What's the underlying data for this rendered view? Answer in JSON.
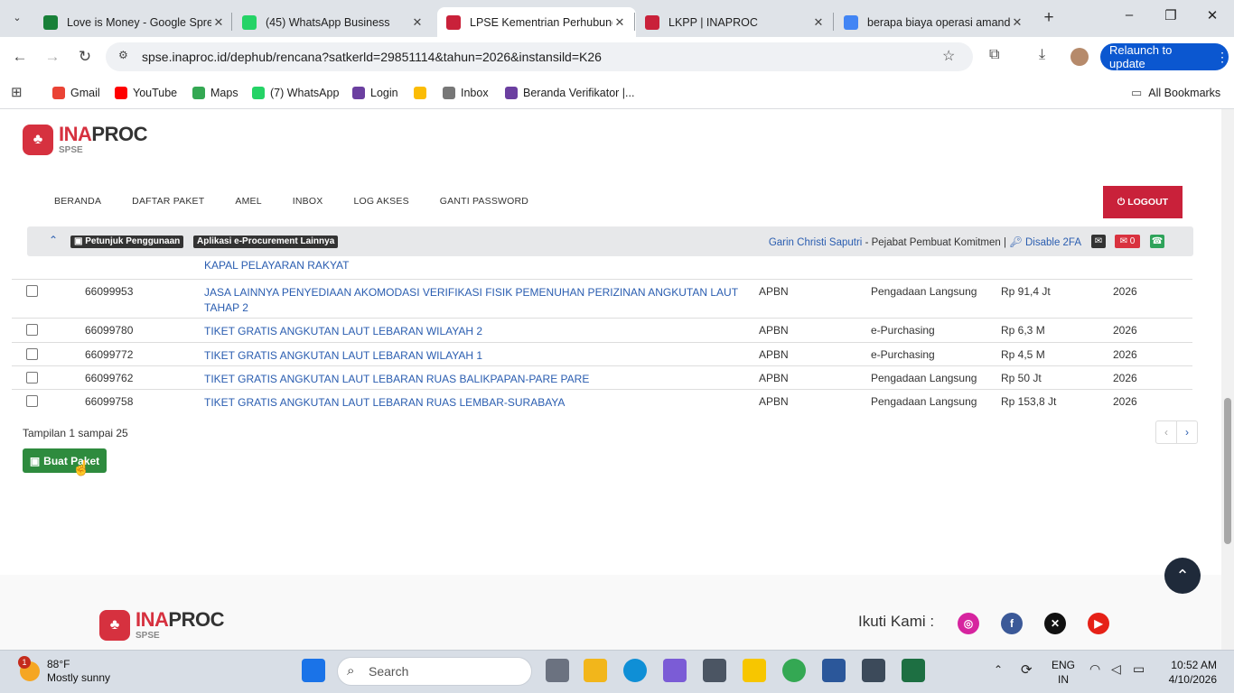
{
  "browser": {
    "tabs": [
      {
        "title": "Love is Money - Google Spre",
        "icon": "sheets-icon",
        "color": "#188038"
      },
      {
        "title": "(45) WhatsApp Business",
        "icon": "whatsapp-icon",
        "color": "#25d366"
      },
      {
        "title": "LPSE Kementrian Perhubung",
        "icon": "lpse-icon",
        "color": "#c9213a"
      },
      {
        "title": "LKPP | INAPROC",
        "icon": "lkpp-icon",
        "color": "#c9213a"
      },
      {
        "title": "berapa biaya operasi amand",
        "icon": "google-icon",
        "color": "#4285f4"
      }
    ],
    "url": "spse.inaproc.id/dephub/rencana?satkerld=29851114&tahun=2026&instansild=K26",
    "relaunch_label": "Relaunch to update",
    "bookmarks": [
      {
        "label": "Gmail",
        "color": "#ea4335"
      },
      {
        "label": "YouTube",
        "color": "#ff0000"
      },
      {
        "label": "Maps",
        "color": "#34a853"
      },
      {
        "label": "(7) WhatsApp",
        "color": "#25d366"
      },
      {
        "label": "Login",
        "color": "#6b3fa0"
      },
      {
        "label": "",
        "color": "#fbbc05"
      },
      {
        "label": "Inbox",
        "color": "#777777"
      },
      {
        "label": "Beranda Verifikator |...",
        "color": "#6b3fa0"
      }
    ],
    "all_bookmarks": "All Bookmarks"
  },
  "site": {
    "logo_main": "INA",
    "logo_bold": "PROC",
    "logo_sub": "SPSE",
    "menu": [
      "BERANDA",
      "DAFTAR PAKET",
      "AMEL",
      "INBOX",
      "LOG AKSES",
      "GANTI PASSWORD"
    ],
    "logout": "LOGOUT",
    "labels": {
      "petunjuk": "Petunjuk Penggunaan",
      "aplikasi": "Aplikasi e-Procurement Lainnya"
    },
    "user_name": "Garin Christi Saputri",
    "user_role": " - Pejabat Pembuat Komitmen | ",
    "disable_2fa": "Disable 2FA",
    "mail_count": "0"
  },
  "table": {
    "partial_row": "KAPAL PELAYARAN RAKYAT",
    "rows": [
      {
        "id": "66099953",
        "name": "JASA LAINNYA PENYEDIAAN AKOMODASI VERIFIKASI FISIK PEMENUHAN PERIZINAN ANGKUTAN LAUT",
        "name2": "TAHAP 2",
        "source": "APBN",
        "method": "Pengadaan Langsung",
        "value": "Rp 91,4 Jt",
        "year": "2026"
      },
      {
        "id": "66099780",
        "name": "TIKET GRATIS ANGKUTAN LAUT LEBARAN WILAYAH 2",
        "name2": "",
        "source": "APBN",
        "method": "e-Purchasing",
        "value": "Rp 6,3 M",
        "year": "2026"
      },
      {
        "id": "66099772",
        "name": "TIKET GRATIS ANGKUTAN LAUT LEBARAN WILAYAH 1",
        "name2": "",
        "source": "APBN",
        "method": "e-Purchasing",
        "value": "Rp 4,5 M",
        "year": "2026"
      },
      {
        "id": "66099762",
        "name": "TIKET GRATIS ANGKUTAN LAUT LEBARAN RUAS BALIKPAPAN-PARE PARE",
        "name2": "",
        "source": "APBN",
        "method": "Pengadaan Langsung",
        "value": "Rp 50 Jt",
        "year": "2026"
      },
      {
        "id": "66099758",
        "name": "TIKET GRATIS ANGKUTAN LAUT LEBARAN RUAS LEMBAR-SURABAYA",
        "name2": "",
        "source": "APBN",
        "method": "Pengadaan Langsung",
        "value": "Rp 153,8 Jt",
        "year": "2026"
      }
    ],
    "showing": "Tampilan 1 sampai 25",
    "prev": "‹",
    "next": "›"
  },
  "buat_paket": "Buat Paket",
  "footer": {
    "follow": "Ikuti Kami :"
  },
  "taskbar": {
    "temp": "88°F",
    "weather": "Mostly sunny",
    "weather_badge": "1",
    "search": "Search",
    "lang1": "ENG",
    "lang2": "IN",
    "time": "10:52 AM",
    "date": "4/10/2026"
  }
}
